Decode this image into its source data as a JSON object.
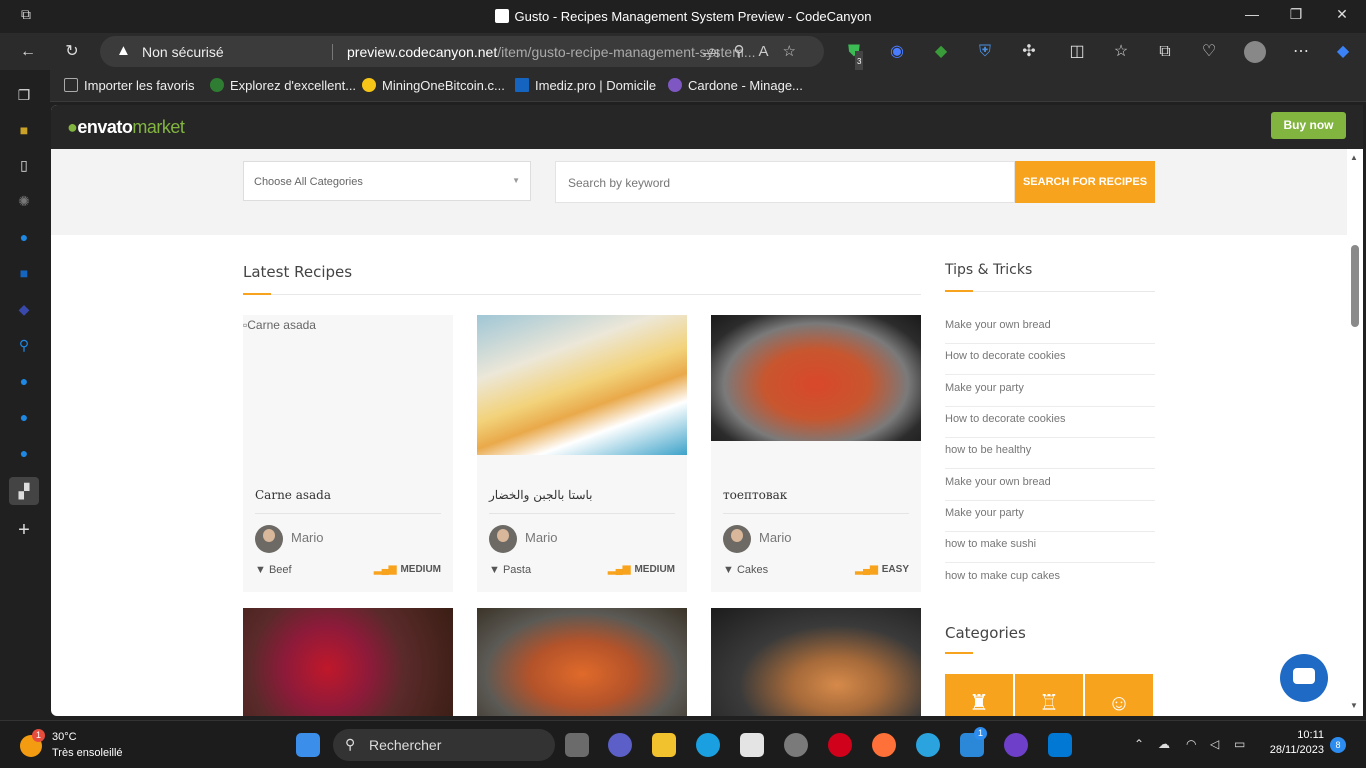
{
  "window": {
    "title": "Gusto - Recipes Management System Preview - CodeCanyon"
  },
  "addressbar": {
    "security": "Non sécurisé",
    "url_domain": "preview.codecanyon.net",
    "url_path": "/item/gusto-recipe-management-system..."
  },
  "bookmarks": [
    {
      "label": "Importer les favoris",
      "color": "#aaaaaa"
    },
    {
      "label": "Explorez d'excellent...",
      "color": "#2e7d32"
    },
    {
      "label": "MiningOneBitcoin.c...",
      "color": "#f5c518"
    },
    {
      "label": "Imediz.pro | Domicile",
      "color": "#1565c0"
    },
    {
      "label": "Cardone - Minage...",
      "color": "#7e57c2"
    }
  ],
  "extension_badge": "3",
  "site": {
    "logo": "envato",
    "logo_suffix": "market",
    "buy_label": "Buy now",
    "category_placeholder": "Choose All Categories",
    "keyword_placeholder": "Search by keyword",
    "search_label": "SEARCH FOR RECIPES",
    "latest_heading": "Latest Recipes",
    "tips_heading": "Tips & Tricks",
    "categories_heading": "Categories",
    "recipes": [
      {
        "name": "Carne asada",
        "alt": "Carne asada",
        "author": "Mario",
        "category": "Beef",
        "difficulty": "MEDIUM"
      },
      {
        "name": "باستا بالجبن والخضار",
        "author": "Mario",
        "category": "Pasta",
        "difficulty": "MEDIUM"
      },
      {
        "name": "тоептовак",
        "author": "Mario",
        "category": "Cakes",
        "difficulty": "EASY"
      }
    ],
    "tips": [
      "Make your own bread",
      "How to decorate cookies",
      "Make your party",
      "How to decorate cookies",
      "how to be healthy",
      "Make your own bread",
      "Make your party",
      "how to make sushi",
      "how to make cup cakes"
    ]
  },
  "taskbar": {
    "temperature": "30°C",
    "weather": "Très ensoleillé",
    "weather_badge": "1",
    "search_label": "Rechercher",
    "mail_badge": "1",
    "time": "10:11",
    "date": "28/11/2023",
    "notifications": "8"
  }
}
